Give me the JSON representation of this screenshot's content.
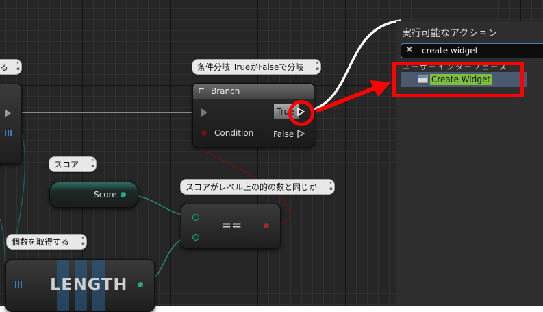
{
  "graph": {
    "comments": {
      "left_partial": "る",
      "branch": "条件分岐 TrueかFalseで分岐",
      "score": "スコア",
      "equals": "スコアがレベル上の的の数と同じか",
      "count": "個数を取得する"
    },
    "branch_node": {
      "title": "Branch",
      "condition_label": "Condition",
      "true_label": "True",
      "false_label": "False"
    },
    "score_node": {
      "label": "Score"
    },
    "equals_node": {
      "symbol": "=="
    },
    "length_node": {
      "title": "LENGTH"
    }
  },
  "action_menu": {
    "title": "実行可能なアクション",
    "search_value": "create widget",
    "category_label": "ユーザーインターフェース",
    "result_label": "Create Widget"
  },
  "colors": {
    "annotation_red": "#ff0000",
    "result_highlight": "#7fbf3f",
    "result_row": "#4b5a70",
    "search_border": "#4c7db8"
  }
}
